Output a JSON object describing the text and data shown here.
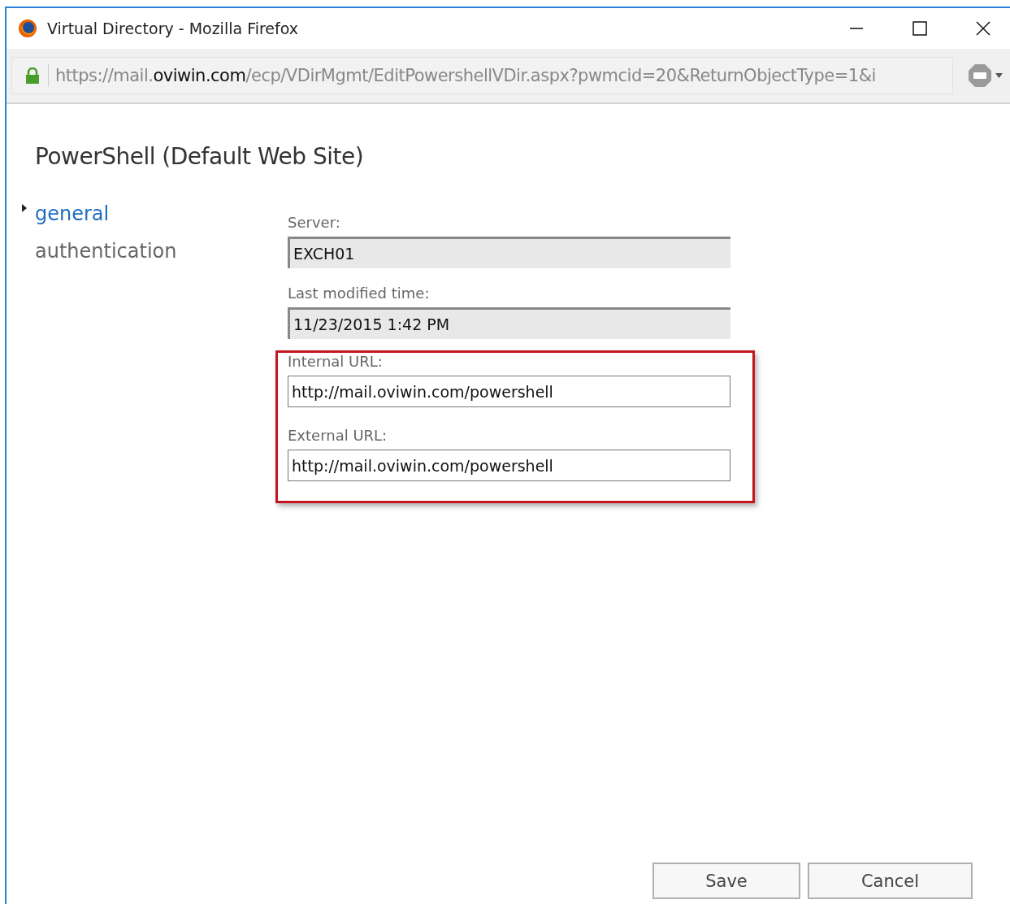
{
  "window": {
    "title": "Virtual Directory - Mozilla Firefox",
    "controls": [
      {
        "kind": "minimize"
      },
      {
        "kind": "maximize"
      },
      {
        "kind": "close"
      }
    ]
  },
  "address_bar": {
    "secure": true,
    "url_prefix": "https://mail.",
    "url_host": "oviwin.com",
    "url_path": "/ecp/VDirMgmt/EditPowershellVDir.aspx?pwmcid=20&ReturnObjectType=1&i"
  },
  "page_title": "PowerShell (Default Web Site)",
  "nav": [
    {
      "label": "general",
      "selected": true
    },
    {
      "label": "authentication",
      "selected": false
    }
  ],
  "fields": [
    {
      "label": "Server:",
      "value": "EXCH01",
      "kind": "readonly",
      "highlighted": false
    },
    {
      "label": "Last modified time:",
      "value": "11/23/2015 1:42 PM",
      "kind": "readonly",
      "highlighted": false
    },
    {
      "label": "Internal URL:",
      "value": "http://mail.oviwin.com/powershell",
      "kind": "editable",
      "highlighted": true
    },
    {
      "label": "External URL:",
      "value": "http://mail.oviwin.com/powershell",
      "kind": "editable",
      "highlighted": true
    }
  ],
  "buttons": [
    {
      "label": "Save"
    },
    {
      "label": "Cancel"
    }
  ]
}
